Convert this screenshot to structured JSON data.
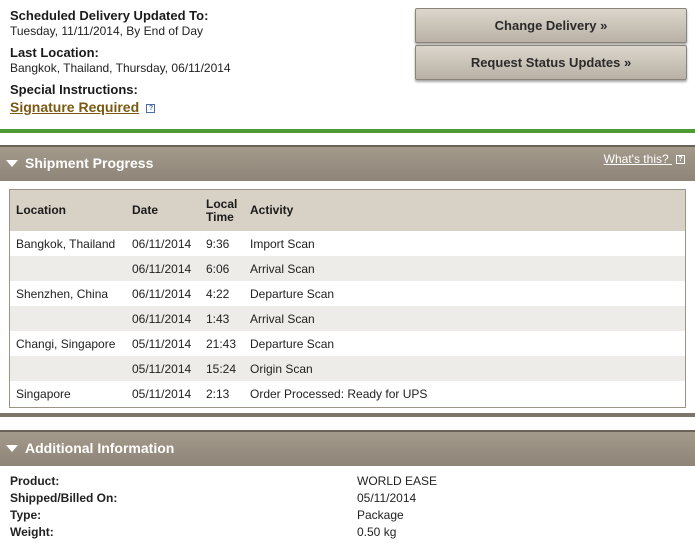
{
  "delivery": {
    "scheduled_label": "Scheduled Delivery Updated To:",
    "scheduled_value": "Tuesday, 11/11/2014, By End of Day",
    "last_location_label": "Last Location:",
    "last_location_value": "Bangkok, Thailand, Thursday, 06/11/2014",
    "special_label": "Special Instructions:",
    "special_value": "Signature Required",
    "help_glyph": "?"
  },
  "buttons": {
    "change_delivery": "Change Delivery »",
    "request_updates": "Request Status Updates »"
  },
  "progress": {
    "title": "Shipment Progress",
    "whats_this": "What's this?",
    "columns": [
      "Location",
      "Date",
      "Local Time",
      "Activity"
    ],
    "rows": [
      {
        "location": "Bangkok, Thailand",
        "date": "06/11/2014",
        "time": "9:36",
        "activity": "Import Scan"
      },
      {
        "location": "",
        "date": "06/11/2014",
        "time": "6:06",
        "activity": "Arrival Scan"
      },
      {
        "location": "Shenzhen, China",
        "date": "06/11/2014",
        "time": "4:22",
        "activity": "Departure Scan"
      },
      {
        "location": "",
        "date": "06/11/2014",
        "time": "1:43",
        "activity": "Arrival Scan"
      },
      {
        "location": "Changi, Singapore",
        "date": "05/11/2014",
        "time": "21:43",
        "activity": "Departure Scan"
      },
      {
        "location": "",
        "date": "05/11/2014",
        "time": "15:24",
        "activity": "Origin Scan"
      },
      {
        "location": "Singapore",
        "date": "05/11/2014",
        "time": "2:13",
        "activity": "Order Processed: Ready for UPS"
      }
    ]
  },
  "additional": {
    "title": "Additional Information",
    "rows": [
      {
        "key": "Product:",
        "value": "WORLD EASE"
      },
      {
        "key": "Shipped/Billed On:",
        "value": "05/11/2014"
      },
      {
        "key": "Type:",
        "value": "Package"
      },
      {
        "key": "Weight:",
        "value": "0.50 kg"
      }
    ]
  }
}
